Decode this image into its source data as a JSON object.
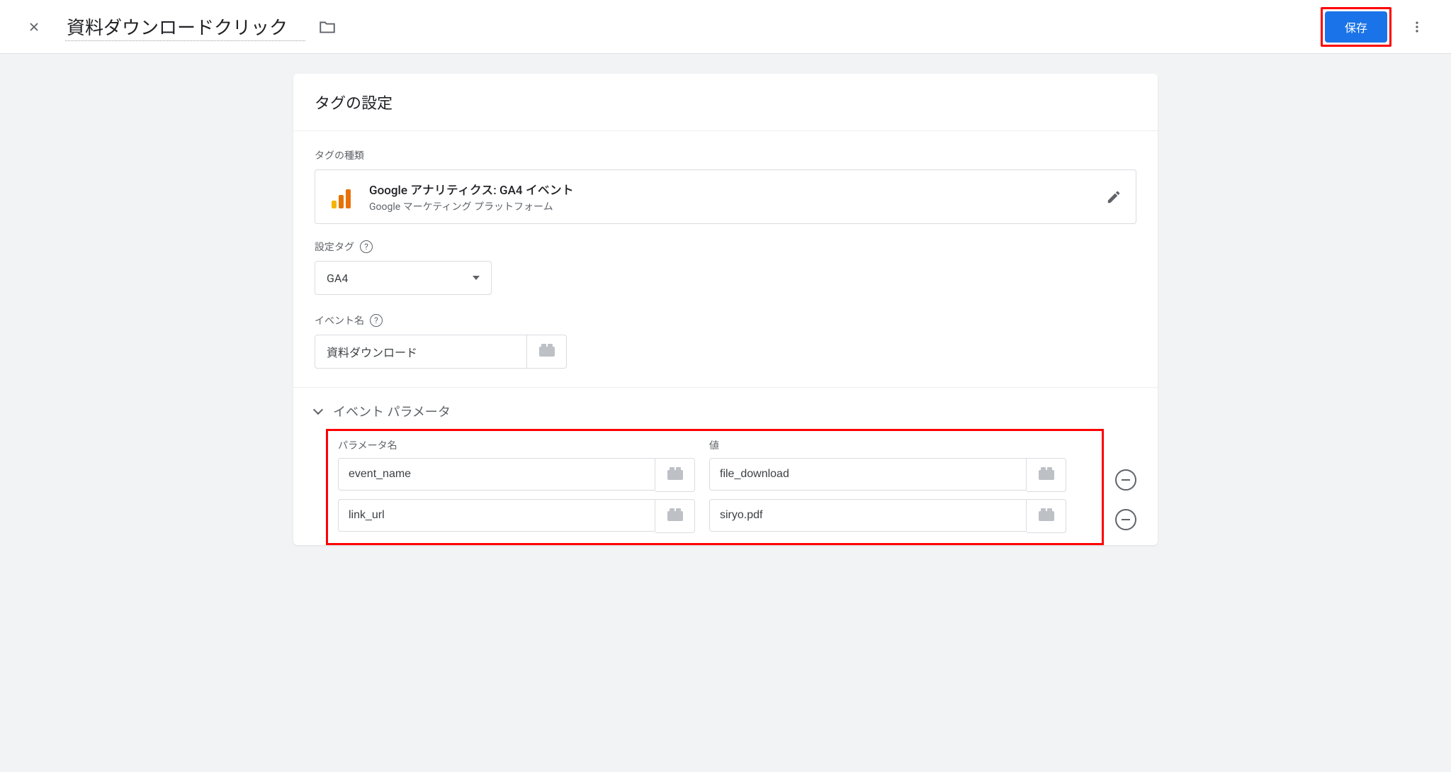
{
  "header": {
    "title": "資料ダウンロードクリック",
    "save_label": "保存"
  },
  "card": {
    "title": "タグの設定",
    "tag_type_label": "タグの種類",
    "tag_type": {
      "name": "Google アナリティクス: GA4 イベント",
      "platform": "Google マーケティング プラットフォーム"
    },
    "config_tag_label": "設定タグ",
    "config_tag_value": "GA4",
    "event_name_label": "イベント名",
    "event_name_value": "資料ダウンロード",
    "event_params_label": "イベント パラメータ",
    "param_name_header": "パラメータ名",
    "param_value_header": "値",
    "params": [
      {
        "name": "event_name",
        "value": "file_download"
      },
      {
        "name": "link_url",
        "value": "siryo.pdf"
      }
    ]
  }
}
